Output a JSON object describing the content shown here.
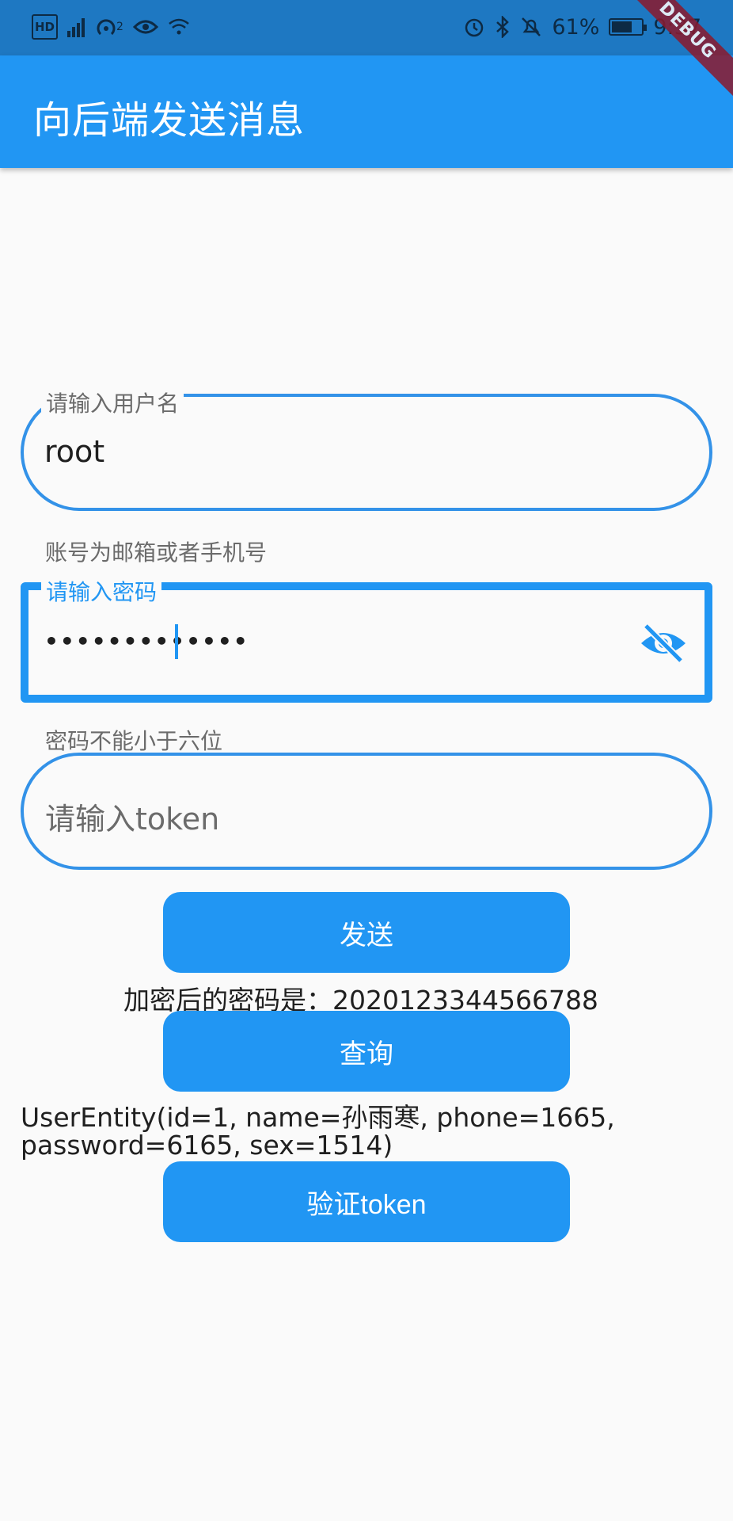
{
  "status_bar": {
    "left_icons": [
      "hd-icon",
      "signal-icon",
      "hotspot-icon",
      "eye-comfort-icon",
      "wifi-icon"
    ],
    "hotspot_count": "2",
    "right_icons": [
      "alarm-icon",
      "bluetooth-icon",
      "mute-icon",
      "battery-icon"
    ],
    "battery_percent": "61%",
    "time": "9:37"
  },
  "debug_banner": "DEBUG",
  "appbar": {
    "title": "向后端发送消息"
  },
  "form": {
    "username": {
      "label": "请输入用户名",
      "value": "root",
      "helper": "账号为邮箱或者手机号"
    },
    "password": {
      "label": "请输入密码",
      "value": "•••••••••••••",
      "helper": "密码不能小于六位",
      "toggle_icon": "visibility-off-icon"
    },
    "token": {
      "placeholder": "请输入token",
      "value": ""
    }
  },
  "buttons": {
    "send": "发送",
    "query": "查询",
    "verify": "验证token"
  },
  "results": {
    "encrypted_password": "加密后的密码是：2020123344566788",
    "user_entity_line1": "UserEntity(id=1, name=孙雨寒, phone=1665,",
    "user_entity_line2": "password=6165, sex=1514)"
  },
  "colors": {
    "primary": "#2196f3",
    "status_bar": "#1e78c2",
    "background": "#fafafa",
    "debug": "#8b1a2e"
  }
}
